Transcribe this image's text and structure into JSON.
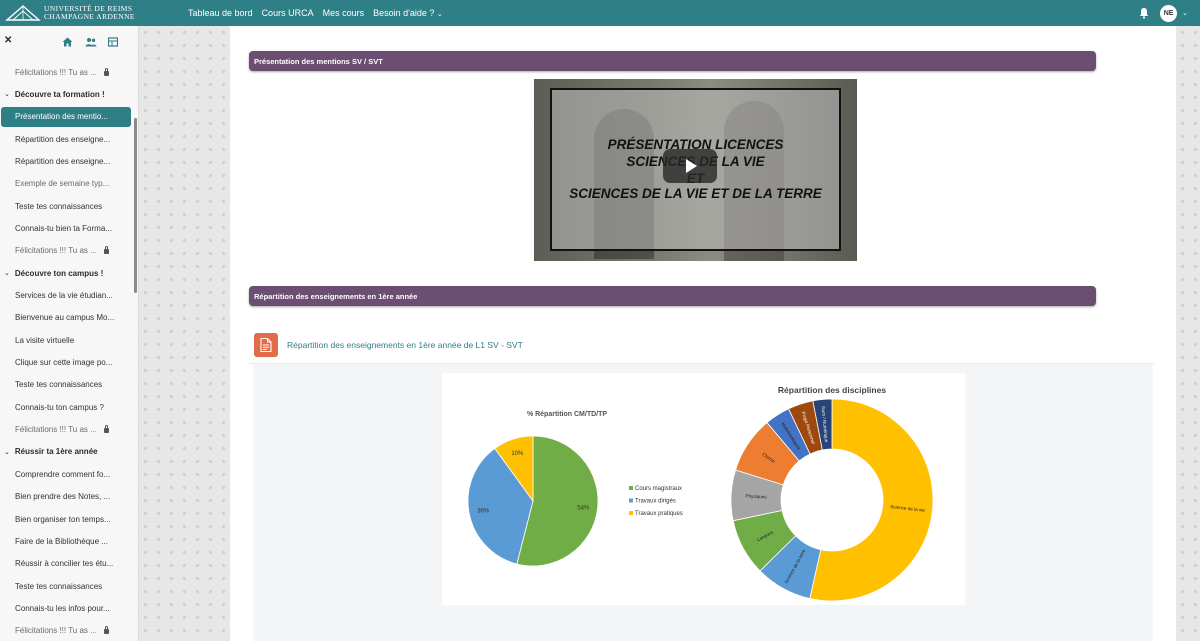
{
  "header": {
    "logo_line1": "Université de Reims",
    "logo_line2": "Champagne Ardenne",
    "nav": [
      "Tableau de bord",
      "Cours URCA",
      "Mes cours",
      "Besoin d'aide ?"
    ],
    "avatar_initials": "NE"
  },
  "sidebar": {
    "items": [
      {
        "type": "item",
        "label": "Félicitations !!! Tu as ...",
        "locked": true
      },
      {
        "type": "section",
        "label": "Découvre ta formation !"
      },
      {
        "type": "item",
        "label": "Présentation des mentio...",
        "active": true
      },
      {
        "type": "item",
        "label": "Répartition des enseigne..."
      },
      {
        "type": "item",
        "label": "Répartition des enseigne..."
      },
      {
        "type": "item",
        "label": "Exemple de semaine typ...",
        "muted": true
      },
      {
        "type": "item",
        "label": "Teste tes connaissances"
      },
      {
        "type": "item",
        "label": "Connais-tu bien ta Forma..."
      },
      {
        "type": "item",
        "label": "Félicitations !!! Tu as ...",
        "locked": true
      },
      {
        "type": "section",
        "label": "Découvre ton campus !"
      },
      {
        "type": "item",
        "label": "Services de la vie étudian..."
      },
      {
        "type": "item",
        "label": "Bienvenue au campus Mo..."
      },
      {
        "type": "item",
        "label": "La visite virtuelle"
      },
      {
        "type": "item",
        "label": "Clique sur cette image po..."
      },
      {
        "type": "item",
        "label": "Teste tes connaissances"
      },
      {
        "type": "item",
        "label": "Connais-tu ton campus ?"
      },
      {
        "type": "item",
        "label": "Félicitations !!! Tu as ...",
        "locked": true
      },
      {
        "type": "section",
        "label": "Réussir ta 1ère année"
      },
      {
        "type": "item",
        "label": "Comprendre comment fo..."
      },
      {
        "type": "item",
        "label": "Bien prendre des Notes, ..."
      },
      {
        "type": "item",
        "label": "Bien organiser ton temps..."
      },
      {
        "type": "item",
        "label": "Faire de la Bibliothèque ..."
      },
      {
        "type": "item",
        "label": "Réussir à concilier tes étu..."
      },
      {
        "type": "item",
        "label": "Teste tes connaissances"
      },
      {
        "type": "item",
        "label": "Connais-tu les infos pour..."
      },
      {
        "type": "item",
        "label": "Félicitations !!! Tu as ...",
        "locked": true
      }
    ]
  },
  "main": {
    "section1_title": "Présentation des mentions SV / SVT",
    "video_title": [
      "PRÉSENTATION LICENCES",
      "SCIENCES DE LA VIE",
      "ET",
      "SCIENCES DE LA VIE ET DE LA TERRE"
    ],
    "section2_title": "Répartition des enseignements en 1ère année",
    "resource_link": "Répartition des enseignements en 1ère année de L1 SV - SVT"
  },
  "chart_data": [
    {
      "type": "pie",
      "title": "% Répartition CM/TD/TP",
      "categories": [
        "Cours magistraux",
        "Travaux dirigés",
        "Travaux pratiques"
      ],
      "values": [
        54,
        36,
        10
      ],
      "value_labels": [
        "54%",
        "36%",
        "10%"
      ],
      "colors": [
        "#70ad47",
        "#5b9bd5",
        "#ffc000"
      ],
      "legend_position": "right"
    },
    {
      "type": "pie",
      "variant": "donut",
      "title": "Répartition des disciplines",
      "categories": [
        "Science de la vie",
        "Science de la terre",
        "Langues",
        "Physiques",
        "Chimie",
        "Mathématiques",
        "Projet Personnel",
        "Num / Numérique"
      ],
      "values": [
        53,
        9,
        9,
        8,
        9,
        4,
        4,
        3
      ],
      "colors": [
        "#ffc000",
        "#5b9bd5",
        "#70ad47",
        "#a5a5a5",
        "#ed7d31",
        "#4472c4",
        "#9e480e",
        "#264478"
      ]
    }
  ]
}
